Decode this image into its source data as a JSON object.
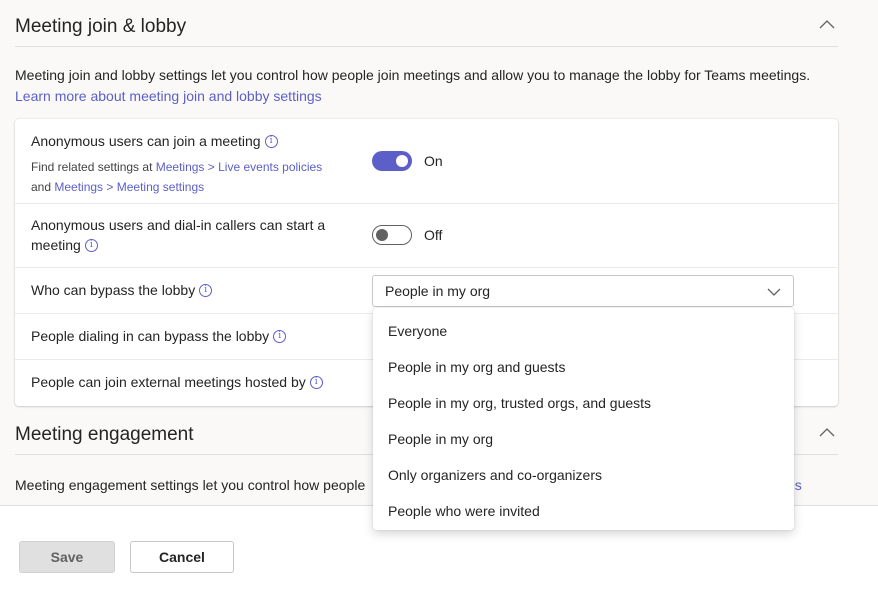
{
  "section1": {
    "title": "Meeting join & lobby",
    "description": "Meeting join and lobby settings let you control how people join meetings and allow you to manage the lobby for Teams meetings.",
    "learn_more": "Learn more about meeting join and lobby settings"
  },
  "settings": {
    "anonymous_join": {
      "label": "Anonymous users can join a meeting",
      "related_prefix": "Find related settings at ",
      "link1a": "Meetings",
      "sep1": " > ",
      "link1b": "Live events policies",
      "and": "and ",
      "link2a": "Meetings",
      "sep2": " > ",
      "link2b": "Meeting settings",
      "state": "On"
    },
    "anonymous_start": {
      "label_line1": "Anonymous users and dial-in callers can start a",
      "label_line2": "meeting",
      "state": "Off"
    },
    "bypass_lobby": {
      "label": "Who can bypass the lobby",
      "selected": "People in my org"
    },
    "dialin_bypass": {
      "label": "People dialing in can bypass the lobby"
    },
    "external_meetings": {
      "label": "People can join external meetings hosted by"
    }
  },
  "dropdown": {
    "options": [
      "Everyone",
      "People in my org and guests",
      "People in my org, trusted orgs, and guests",
      "People in my org",
      "Only organizers and co-organizers",
      "People who were invited"
    ]
  },
  "section2": {
    "title": "Meeting engagement",
    "description_visible": "Meeting engagement settings let you control how people",
    "link_fragment": "gs"
  },
  "footer": {
    "save": "Save",
    "cancel": "Cancel"
  },
  "colors": {
    "accent": "#5b5fc7",
    "toggle_on": "#5b5fc7",
    "disabled_button": "#e0e0e0"
  }
}
